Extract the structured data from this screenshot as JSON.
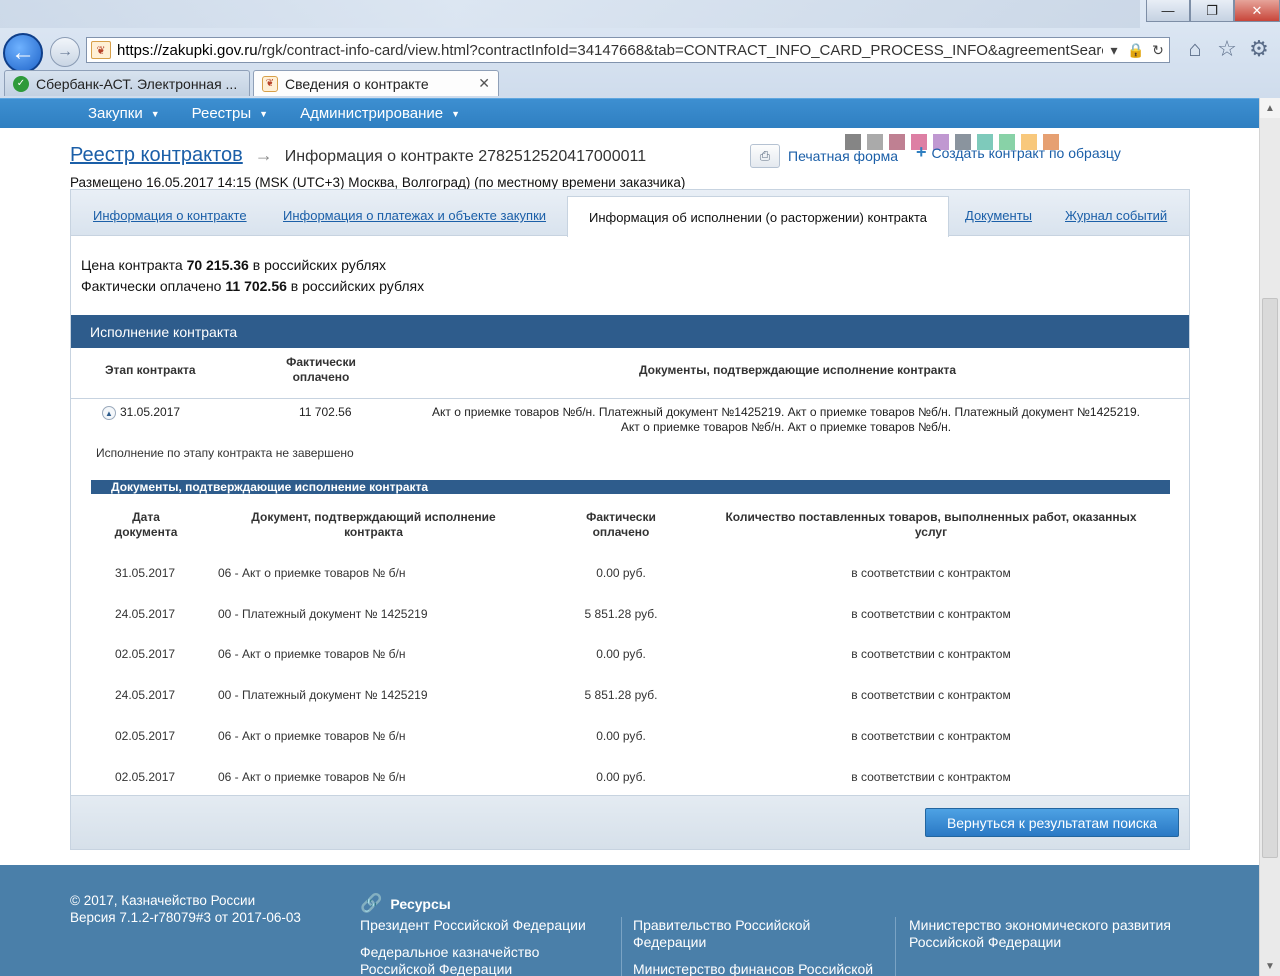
{
  "browser": {
    "url_host": "https://zakupki.gov.ru",
    "url_rest": "/rgk/contract-info-card/view.html?contractInfoId=34147668&tab=CONTRACT_INFO_CARD_PROCESS_INFO&agreementSearc",
    "tabs": [
      {
        "label": "Сбербанк-АСТ. Электронная ..."
      },
      {
        "label": "Сведения о контракте"
      }
    ]
  },
  "menu": {
    "items": [
      {
        "label": "Закупки"
      },
      {
        "label": "Реестры"
      },
      {
        "label": "Администрирование"
      }
    ]
  },
  "header": {
    "breadcrumb_link": "Реестр контрактов",
    "breadcrumb_current": "Информация о контракте 2782512520417000011",
    "print_form": "Печатная форма",
    "create_copy": "Создать контракт по образцу",
    "posted": "Размещено 16.05.2017 14:15 (MSK (UTC+3) Москва, Волгоград) (по местному времени заказчика)"
  },
  "tabs": [
    {
      "label": "Информация о контракте"
    },
    {
      "label": "Информация о платежах и объекте закупки"
    },
    {
      "label": "Информация об исполнении (о расторжении) контракта"
    },
    {
      "label": "Документы"
    },
    {
      "label": "Журнал событий"
    }
  ],
  "summary": {
    "price_prefix": "Цена контракта",
    "price_value": "70 215.36",
    "price_suffix": "в российских рублях",
    "paid_prefix": "Фактически оплачено",
    "paid_value": "11 702.56",
    "paid_suffix": "в российских рублях"
  },
  "execution": {
    "section_title": "Исполнение контракта",
    "col_stage": "Этап контракта",
    "col_paid_1": "Фактически",
    "col_paid_2": "оплачено",
    "col_docs": "Документы, подтверждающие исполнение контракта",
    "stage_date": "31.05.2017",
    "stage_paid": "11 702.56",
    "stage_docs_line1": "Акт о приемке товаров №б/н. Платежный документ №1425219. Акт о приемке товаров №б/н. Платежный документ №1425219.",
    "stage_docs_line2": "Акт о приемке товаров №б/н. Акт о приемке товаров №б/н.",
    "stage_note": "Исполнение по этапу контракта не завершено"
  },
  "documents": {
    "section_title": "Документы, подтверждающие исполнение контракта",
    "col_date_1": "Дата",
    "col_date_2": "документа",
    "col_doc_1": "Документ, подтверждающий исполнение",
    "col_doc_2": "контракта",
    "col_paid_1": "Фактически",
    "col_paid_2": "оплачено",
    "col_qty_1": "Количество поставленных товаров, выполненных работ, оказанных",
    "col_qty_2": "услуг",
    "rows": [
      {
        "date": "31.05.2017",
        "doc": "06 - Акт о приемке товаров № б/н",
        "paid": "0.00 руб.",
        "qty": "в соответствии с контрактом"
      },
      {
        "date": "24.05.2017",
        "doc": "00 - Платежный документ № 1425219",
        "paid": "5 851.28 руб.",
        "qty": "в соответствии с контрактом"
      },
      {
        "date": "02.05.2017",
        "doc": "06 - Акт о приемке товаров № б/н",
        "paid": "0.00 руб.",
        "qty": "в соответствии с контрактом"
      },
      {
        "date": "24.05.2017",
        "doc": "00 - Платежный документ № 1425219",
        "paid": "5 851.28 руб.",
        "qty": "в соответствии с контрактом"
      },
      {
        "date": "02.05.2017",
        "doc": "06 - Акт о приемке товаров № б/н",
        "paid": "0.00 руб.",
        "qty": "в соответствии с контрактом"
      },
      {
        "date": "02.05.2017",
        "doc": "06 - Акт о приемке товаров № б/н",
        "paid": "0.00 руб.",
        "qty": "в соответствии с контрактом"
      }
    ]
  },
  "actions": {
    "back_to_results": "Вернуться к результатам поиска"
  },
  "footer": {
    "copyright": "© 2017, Казначейство России",
    "version": "Версия 7.1.2-r78079#3 от 2017-06-03",
    "resources_title": "Ресурсы",
    "links": [
      {
        "line1": "Президент Российской Федерации",
        "line2": ""
      },
      {
        "line1": "Федеральное казначейство",
        "line2": "Российской Федерации"
      },
      {
        "line1": "Правительство Российской",
        "line2": "Федерации"
      },
      {
        "line1": "Министерство финансов Российской",
        "line2": ""
      },
      {
        "line1": "Министерство экономического развития",
        "line2": "Российской Федерации"
      }
    ]
  },
  "icons": {
    "back": "back-arrow-icon",
    "forward": "forward-arrow-icon",
    "home": "home-icon",
    "favorites": "star-icon",
    "settings": "gear-icon",
    "print": "printer-icon",
    "plus": "plus-icon",
    "link": "chain-link-icon"
  },
  "colors": {
    "menu_bar": "#2f7fc1",
    "section_header": "#2e5c8c",
    "link": "#1b5fa8",
    "footer": "#4a7fa9"
  }
}
